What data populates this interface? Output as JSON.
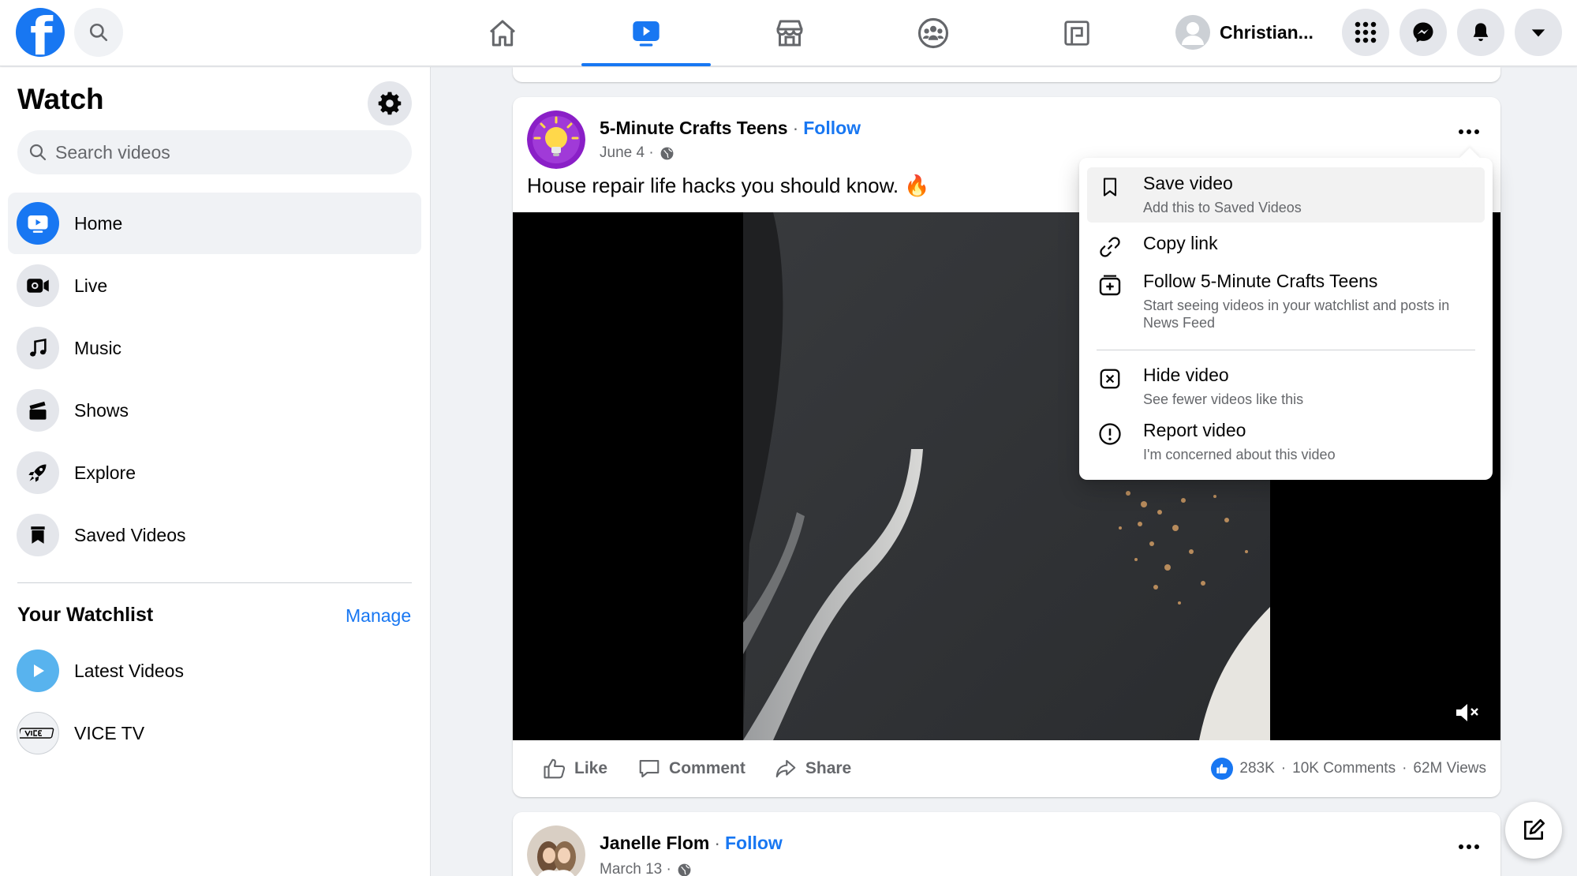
{
  "topbar": {
    "profile_name": "Christian...",
    "nav_tabs": [
      "home",
      "watch",
      "marketplace",
      "groups",
      "gaming"
    ]
  },
  "sidebar": {
    "title": "Watch",
    "search_placeholder": "Search videos",
    "items": [
      {
        "label": "Home"
      },
      {
        "label": "Live"
      },
      {
        "label": "Music"
      },
      {
        "label": "Shows"
      },
      {
        "label": "Explore"
      },
      {
        "label": "Saved Videos"
      }
    ],
    "watchlist_heading": "Your Watchlist",
    "manage_label": "Manage",
    "watchlist": [
      {
        "label": "Latest Videos"
      },
      {
        "label": "VICE TV"
      }
    ]
  },
  "post": {
    "page_name": "5-Minute Crafts Teens",
    "separator": "·",
    "follow_label": "Follow",
    "date": "June 4 ·",
    "text": "House repair life hacks you should know. 🔥",
    "actions": {
      "like": "Like",
      "comment": "Comment",
      "share": "Share"
    },
    "stats": {
      "reactions": "283K",
      "comments": "10K Comments",
      "views": "62M Views",
      "dot": "·"
    }
  },
  "menu": {
    "items": [
      {
        "title": "Save video",
        "sub": "Add this to Saved Videos"
      },
      {
        "title": "Copy link",
        "sub": ""
      },
      {
        "title": "Follow 5-Minute Crafts Teens",
        "sub": "Start seeing videos in your watchlist and posts in News Feed"
      },
      {
        "title": "Hide video",
        "sub": "See fewer videos like this"
      },
      {
        "title": "Report video",
        "sub": "I'm concerned about this video"
      }
    ]
  },
  "post2": {
    "page_name": "Janelle Flom",
    "separator": "·",
    "follow_label": "Follow",
    "date": "March 13 ·"
  },
  "colors": {
    "accent": "#1877f2",
    "background": "#f0f2f5",
    "secondary_text": "#65676b"
  }
}
